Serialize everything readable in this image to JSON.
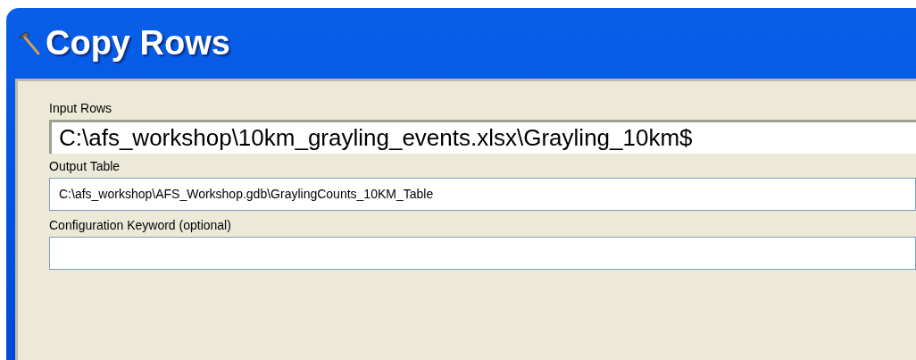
{
  "window": {
    "title": "Copy Rows"
  },
  "fields": [
    {
      "label": "Input Rows",
      "value": "C:\\afs_workshop\\10km_grayling_events.xlsx\\Grayling_10km$"
    },
    {
      "label": "Output Table",
      "value": "C:\\afs_workshop\\AFS_Workshop.gdb\\GraylingCounts_10KM_Table"
    },
    {
      "label": "Configuration Keyword (optional)"
    }
  ]
}
